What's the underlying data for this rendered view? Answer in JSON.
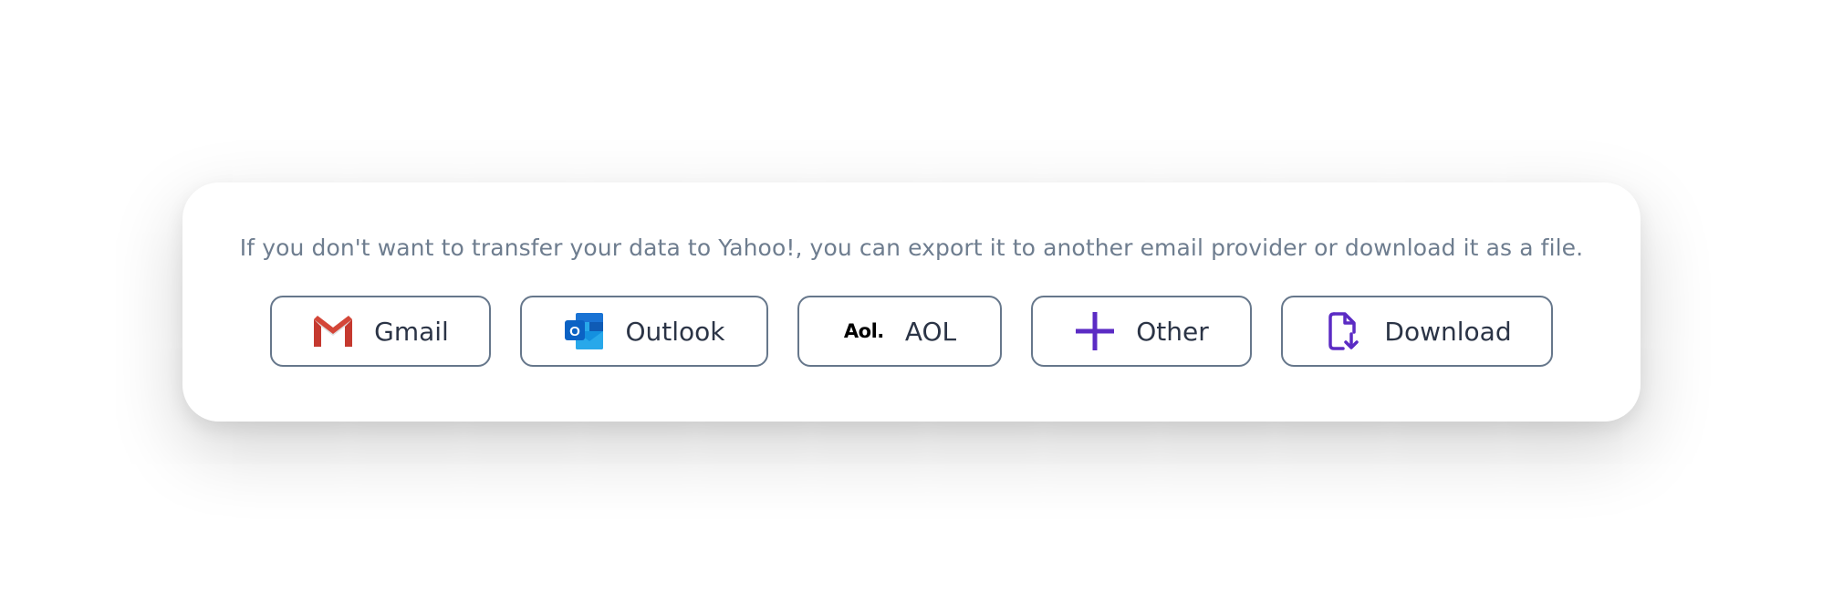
{
  "message": "If you don't want to transfer your data to Yahoo!, you can export it to another email provider or download it as a file.",
  "buttons": {
    "gmail": {
      "label": "Gmail",
      "icon": "gmail-icon"
    },
    "outlook": {
      "label": "Outlook",
      "icon": "outlook-icon"
    },
    "aol": {
      "label": "AOL",
      "icon": "aol-icon",
      "icon_text": "Aol."
    },
    "other": {
      "label": "Other",
      "icon": "plus-icon"
    },
    "download": {
      "label": "Download",
      "icon": "file-download-icon"
    }
  },
  "colors": {
    "accent": "#5b2bc4",
    "border": "#66778b",
    "text": "#2b3446",
    "muted": "#6e7d8f"
  }
}
